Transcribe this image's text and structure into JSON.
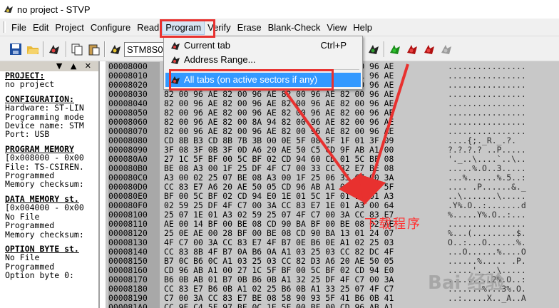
{
  "window": {
    "title": "no project - STVP"
  },
  "menu": {
    "items": [
      "File",
      "Edit",
      "Project",
      "Configure",
      "Read",
      "Program",
      "Verify",
      "Erase",
      "Blank-Check",
      "View",
      "Help"
    ],
    "active": "Program"
  },
  "toolbar": {
    "device": "STM8S00"
  },
  "program_menu": {
    "items": [
      {
        "label": "Current tab",
        "shortcut": "Ctrl+P"
      },
      {
        "label": "Address Range...",
        "shortcut": ""
      },
      {
        "label": "All tabs (on active sectors if any)",
        "shortcut": ""
      }
    ],
    "highlighted": 2
  },
  "left_panel": {
    "controls": "▼ ▲ ✕",
    "lines": [
      {
        "text": "PROJECT:",
        "head": true
      },
      {
        "text": "no project"
      },
      {
        "gap": true
      },
      {
        "text": "CONFIGURATION:",
        "head": true
      },
      {
        "text": "Hardware: ST-LIN"
      },
      {
        "text": "Programming mode"
      },
      {
        "text": "Device name: STM"
      },
      {
        "text": "Port: USB"
      },
      {
        "gap": true
      },
      {
        "text": "PROGRAM MEMORY",
        "head": true
      },
      {
        "text": "[0x008000 - 0x00"
      },
      {
        "text": "File: TS-CSIREN."
      },
      {
        "text": "Programmed"
      },
      {
        "text": "Memory checksum:"
      },
      {
        "gap": true
      },
      {
        "text": "DATA MEMORY st.",
        "head": true
      },
      {
        "text": "[0x004000 - 0x00"
      },
      {
        "text": "No File"
      },
      {
        "text": "Programmed"
      },
      {
        "text": "Memory checksum:"
      },
      {
        "gap": true
      },
      {
        "text": "OPTION BYTE st.",
        "head": true
      },
      {
        "text": "No File"
      },
      {
        "text": "Programmed"
      },
      {
        "text": "Option byte 0:"
      }
    ]
  },
  "hex_rows": [
    {
      "addr": "00008000",
      "bytes": "82 00 96 AE 82 00 96 AE 82 00 96 AE 82 00 96 AE",
      "ascii": "................"
    },
    {
      "addr": "00008010",
      "bytes": "82 00 96 AE 82 00 96 AE 82 00 96 AE 82 01 96 AE",
      "ascii": "................"
    },
    {
      "addr": "00008020",
      "bytes": "82 00 96 AE 82 00 96 AE 82 00 96 AE 82 00 96 AE",
      "ascii": "................"
    },
    {
      "addr": "00008030",
      "bytes": "82 00 96 AE 82 00 96 AE 82 00 96 AE 82 00 96 AE",
      "ascii": "................"
    },
    {
      "addr": "00008040",
      "bytes": "82 00 96 AE 82 00 96 AE 82 00 96 AE 82 00 96 AE",
      "ascii": "................"
    },
    {
      "addr": "00008050",
      "bytes": "82 00 96 AE 82 00 96 AE 82 00 96 AE 82 00 96 AE",
      "ascii": "................"
    },
    {
      "addr": "00008060",
      "bytes": "82 00 96 AE 82 00 8A 94 82 00 96 AE 82 00 96 AE",
      "ascii": "................"
    },
    {
      "addr": "00008070",
      "bytes": "82 00 96 AE 82 00 96 AE 82 00 96 AE 82 00 96 AE",
      "ascii": "................"
    },
    {
      "addr": "00008080",
      "bytes": "CD 8B B3 CD 8B 7B 3B 00 0E 5F 08 5F 1F 01 3F 09",
      "ascii": "....{;._R._.?."
    },
    {
      "addr": "00008090",
      "bytes": "3F 08 3F 0B 3F 0D A6 20 AE 50 C5 CD 9F AB A1 00",
      "ascii": "?.?.?.? ..P....."
    },
    {
      "addr": "000080A0",
      "bytes": "27 1C 5F BF 00 5C BF 02 CD 94 60 CD 01 5C BF 08",
      "ascii": "'._..\\....`..\\.."
    },
    {
      "addr": "000080B0",
      "bytes": "BE 08 A3 00 1F 25 DF 4F C7 00 33 CC 82 E7 BE 08",
      "ascii": ".....%.O..3....."
    },
    {
      "addr": "000080C0",
      "bytes": "A3 00 02 25 07 BE 08 A3 00 1F 25 06 35 C7 00 3A",
      "ascii": "...%......%.5..:"
    },
    {
      "addr": "000080D0",
      "bytes": "CC 83 E7 A6 20 AE 50 05 CD 96 AB A1 00 26 1C 5F",
      "ascii": ".... .P......&._"
    },
    {
      "addr": "000080E0",
      "bytes": "BF 00 5C BF 02 CD 94 E0 1E 01 5C 1F 01 1E 01 A3",
      "ascii": "..\\.......\\....."
    },
    {
      "addr": "000080F0",
      "bytes": "02 59 25 DF 4F C7 00 3A CC 83 E7 1E 01 A3 00 64",
      "ascii": ".Y%.O..:.......d"
    },
    {
      "addr": "00008100",
      "bytes": "25 07 1E 01 A3 02 59 25 07 4F C7 00 3A CC 83 E7",
      "ascii": "%.....Y%.O..:..."
    },
    {
      "addr": "00008110",
      "bytes": "AE 00 14 BF 00 BE 08 CD 90 BA BF 00 BE 08 02 AE",
      "ascii": "................"
    },
    {
      "addr": "00008120",
      "bytes": "25 0E AE 00 28 BF 00 BE 08 CD 90 BA 13 01 24 07",
      "ascii": "%...(.........$."
    },
    {
      "addr": "00008130",
      "bytes": "4F C7 00 3A CC 83 E7 4F B7 0E B6 0E A1 02 25 03",
      "ascii": "O..:...O......%."
    },
    {
      "addr": "00008140",
      "bytes": "CC 83 8B 4F B7 0A B6 0A A1 03 25 03 CC 82 DC 4F",
      "ascii": "...O......%....O"
    },
    {
      "addr": "00008150",
      "bytes": "B7 0C B6 0C A1 03 25 03 CC 82 D3 A6 20 AE 50 05",
      "ascii": "......%..... .P."
    },
    {
      "addr": "00008160",
      "bytes": "CD 96 AB A1 00 27 1C 5F BF 00 5C BF 02 CD 94 E0",
      "ascii": ".....'._..\\....."
    },
    {
      "addr": "00008170",
      "bytes": "B6 0B AB 01 B7 0B B6 0B A1 32 25 DF 4F C7 00 3A",
      "ascii": ".........2%.O..:"
    },
    {
      "addr": "00008180",
      "bytes": "CC 83 E7 B6 0B A1 02 25 B6 0B A1 33 25 07 4F C7",
      "ascii": ".......%...3%.O."
    },
    {
      "addr": "00008190",
      "bytes": "C7 00 3A CC 83 E7 BE 08 58 90 93 5F 41 B6 0B 41",
      "ascii": "..:.....X.._A..A"
    },
    {
      "addr": "000081A0",
      "bytes": "CC 9F C4 5F 97 BF 0C 1E 5F 00 BF 00 CD 96 AB A1",
      "ascii": "..._...._......."
    }
  ],
  "annotation": "下载程序",
  "watermark": "Bai 经验"
}
